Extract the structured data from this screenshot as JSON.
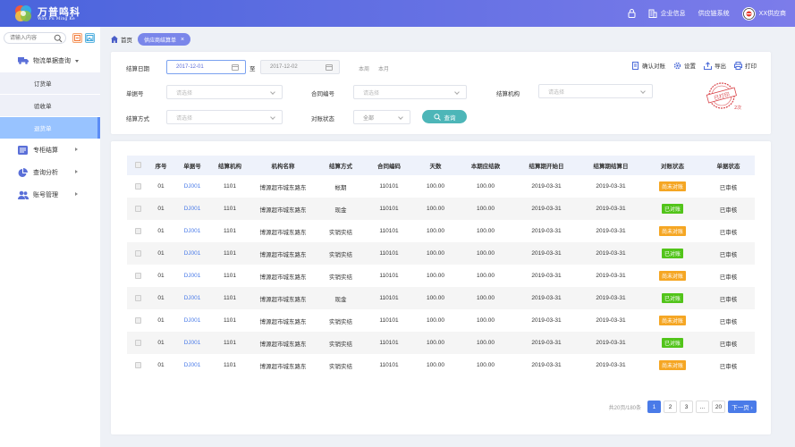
{
  "brand": {
    "name": "万普鸣科",
    "subtitle": "Wan Pu Ming Ke"
  },
  "topbar": {
    "company_info": "企业信息",
    "supply_chain": "供应链系统",
    "user": "XX供应商"
  },
  "sidebar": {
    "search_placeholder": "请输入内容",
    "menu": [
      {
        "label": "物流单据查询",
        "icon": "truck-icon",
        "expanded": true
      },
      {
        "label": "专柜结算",
        "icon": "ledger-icon"
      },
      {
        "label": "查询分析",
        "icon": "pie-chart-icon"
      },
      {
        "label": "账号管理",
        "icon": "users-icon"
      }
    ],
    "submenu": [
      "订货单",
      "验收单",
      "退货单"
    ],
    "active_submenu": "退货单"
  },
  "breadcrumb": {
    "home": "首页",
    "tab": "供应商结算单"
  },
  "filters": {
    "settle_date_label": "结算日期",
    "date_start": "2017-12-01",
    "to": "至",
    "date_end": "2017-12-02",
    "this_week": "本周",
    "this_month": "本月",
    "doc_no_label": "单据号",
    "contract_label": "合同编号",
    "org_label": "结算机构",
    "method_label": "结算方式",
    "recon_label": "对账状态",
    "select_placeholder": "请选择",
    "recon_value": "全部",
    "query_btn": "查询"
  },
  "toolbar": {
    "confirm": "确认对账",
    "settings": "设置",
    "export": "导出",
    "print": "打印"
  },
  "stamp": {
    "text": "已打印",
    "count": "2次",
    "color": "#d9474c"
  },
  "table": {
    "headers": [
      "",
      "序号",
      "单据号",
      "结算机构",
      "机构名称",
      "结算方式",
      "合同编码",
      "天数",
      "本期应结款",
      "结算期开始日",
      "结算期结算日",
      "对账状态",
      "单据状态"
    ],
    "rows": [
      [
        "",
        "01",
        "DJ001",
        "1101",
        "博源超市城东路东",
        "帐期",
        "110101",
        "100.00",
        "100.00",
        "2019-03-31",
        "2019-03-31",
        "尚未对账",
        "已审核"
      ],
      [
        "",
        "01",
        "DJ001",
        "1101",
        "博源超市城东路东",
        "现金",
        "110101",
        "100.00",
        "100.00",
        "2019-03-31",
        "2019-03-31",
        "已对账",
        "已审核"
      ],
      [
        "",
        "01",
        "DJ001",
        "1101",
        "博源超市城东路东",
        "实销实结",
        "110101",
        "100.00",
        "100.00",
        "2019-03-31",
        "2019-03-31",
        "尚未对账",
        "已审核"
      ],
      [
        "",
        "01",
        "DJ001",
        "1101",
        "博源超市城东路东",
        "实销实结",
        "110101",
        "100.00",
        "100.00",
        "2019-03-31",
        "2019-03-31",
        "已对账",
        "已审核"
      ],
      [
        "",
        "01",
        "DJ001",
        "1101",
        "博源超市城东路东",
        "实销实结",
        "110101",
        "100.00",
        "100.00",
        "2019-03-31",
        "2019-03-31",
        "尚未对账",
        "已审核"
      ],
      [
        "",
        "01",
        "DJ001",
        "1101",
        "博源超市城东路东",
        "现金",
        "110101",
        "100.00",
        "100.00",
        "2019-03-31",
        "2019-03-31",
        "已对账",
        "已审核"
      ],
      [
        "",
        "01",
        "DJ001",
        "1101",
        "博源超市城东路东",
        "实销实结",
        "110101",
        "100.00",
        "100.00",
        "2019-03-31",
        "2019-03-31",
        "尚未对账",
        "已审核"
      ],
      [
        "",
        "01",
        "DJ001",
        "1101",
        "博源超市城东路东",
        "实销实结",
        "110101",
        "100.00",
        "100.00",
        "2019-03-31",
        "2019-03-31",
        "已对账",
        "已审核"
      ],
      [
        "",
        "01",
        "DJ001",
        "1101",
        "博源超市城东路东",
        "实销实结",
        "110101",
        "100.00",
        "100.00",
        "2019-03-31",
        "2019-03-31",
        "尚未对账",
        "已审核"
      ]
    ],
    "status_colors": {
      "尚未对账": "#f5a623",
      "已对账": "#52c41a"
    }
  },
  "pagination": {
    "total": "共20页/180条",
    "pages": [
      "1",
      "2",
      "3",
      "...",
      "20"
    ],
    "current": "1",
    "next": "下一页 ›"
  }
}
